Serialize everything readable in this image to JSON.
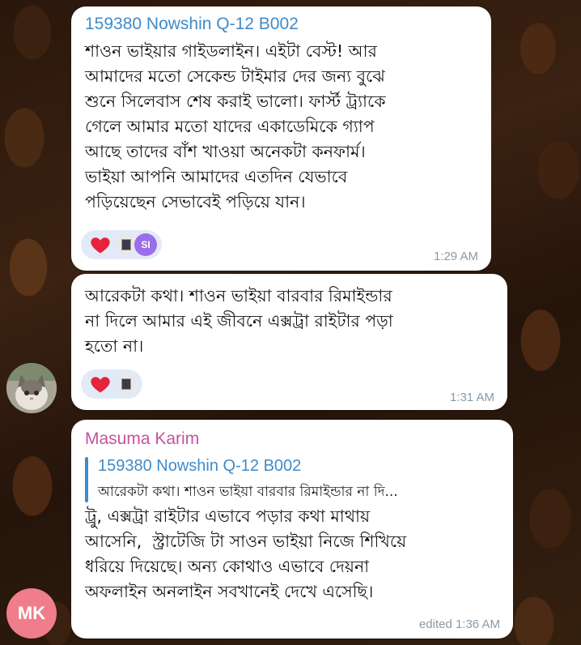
{
  "colors": {
    "sender_blue": "#3f8bc9",
    "sender_pink": "#c4549c",
    "time_gray": "#8a9aa6",
    "reaction_bg": "#e3eaf7",
    "heart_red": "#e5233a",
    "mk_avatar": "#f07e8a",
    "si_badge": "#9a6ee8"
  },
  "messages": [
    {
      "sender": "159380 Nowshin Q-12 B002",
      "text": "শাওন ভাইয়ার গাইডলাইন। এইটা বেস্ট! আর\nআমাদের মতো সেকেন্ড টাইমার দের জন্য বুঝে\nশুনে সিলেবাস শেষ করাই ভালো। ফার্স্ট ট্র্যাকে\nগেলে আমার মতো যাদের একাডেমিকে গ্যাপ\nআছে তাদের বাঁশ খাওয়া অনেকটা কনফার্ম।\nভাইয়া আপনি আমাদের এতদিন যেভাবে\nপড়িয়েছেন সেভাবেই পড়িয়ে যান।",
      "reactions": {
        "emoji": "heart",
        "reactor_badge": "SI"
      },
      "time": "1:29 AM"
    },
    {
      "text": "আরেকটা কথা। শাওন ভাইয়া বারবার রিমাইন্ডার\nনা দিলে আমার এই জীবনে এক্সট্রা রাইটার পড়া\nহতো না।",
      "reactions": {
        "emoji": "heart"
      },
      "time": "1:31 AM"
    },
    {
      "sender": "Masuma Karim",
      "reply": {
        "sender": "159380 Nowshin Q-12 B002",
        "snippet": "আরেকটা কথা। শাওন ভাইয়া বারবার রিমাইন্ডার না দি..."
      },
      "text": "ট্রু, এক্সট্রা রাইটার এভাবে পড়ার কথা মাথায়\nআসেনি,  স্ট্রাটেজি টা সাওন ভাইয়া নিজে শিখিয়ে\nধরিয়ে দিয়েছে। অন্য কোথাও এভাবে দেয়না\nঅফলাইন অনলাইন সবখানেই দেখে এসেছি।",
      "time": "edited 1:36 AM",
      "avatar_initials": "MK"
    }
  ]
}
